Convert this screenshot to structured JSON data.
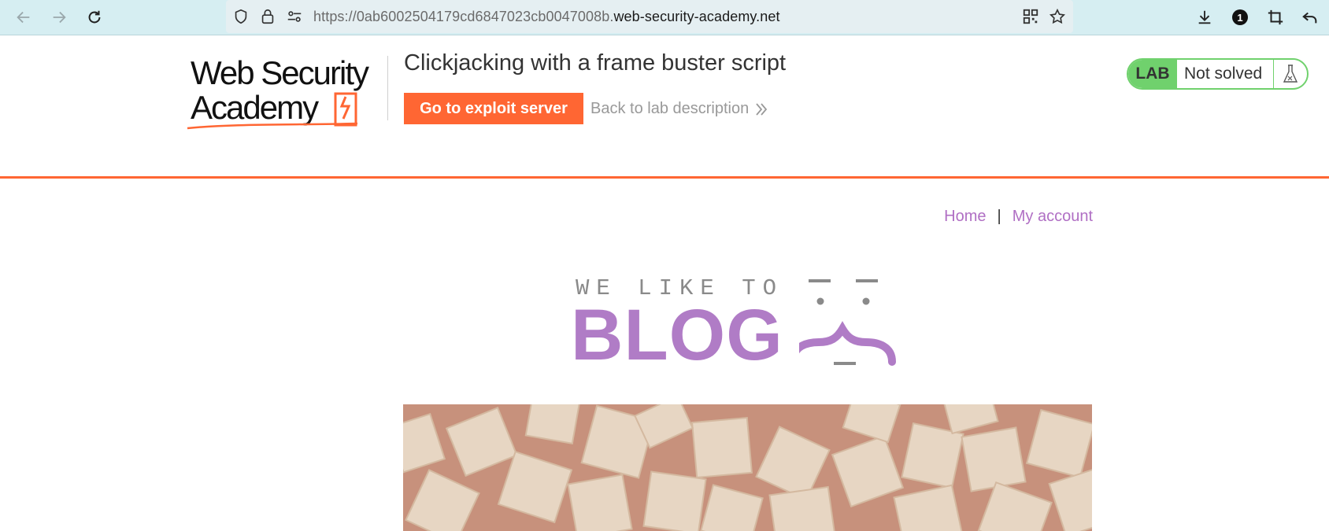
{
  "browser": {
    "url_prefix": "https://0ab6002504179cd6847023cb0047008b.",
    "url_domain": "web-security-academy.net",
    "extension_badge": "1"
  },
  "lab": {
    "logo_line1": "Web Security",
    "logo_line2": "Academy",
    "title": "Clickjacking with a frame buster script",
    "exploit_button": "Go to exploit server",
    "back_link": "Back to lab description",
    "status_badge": "LAB",
    "status_text": "Not solved",
    "accent_color": "#ff6633",
    "status_color": "#70d16d"
  },
  "blog": {
    "nav_home": "Home",
    "nav_separator": "|",
    "nav_account": "My account",
    "banner_small": "WE LIKE TO",
    "banner_big": "BLOG",
    "link_color": "#b06fc4"
  },
  "icons": {
    "back": "arrow-left-icon",
    "forward": "arrow-right-icon",
    "reload": "reload-icon",
    "shield": "shield-icon",
    "lock": "lock-icon",
    "permissions": "permissions-icon",
    "qr": "qr-code-icon",
    "star": "star-icon",
    "download": "download-icon",
    "crop": "crop-icon",
    "undo": "undo-icon",
    "flask": "flask-icon"
  }
}
